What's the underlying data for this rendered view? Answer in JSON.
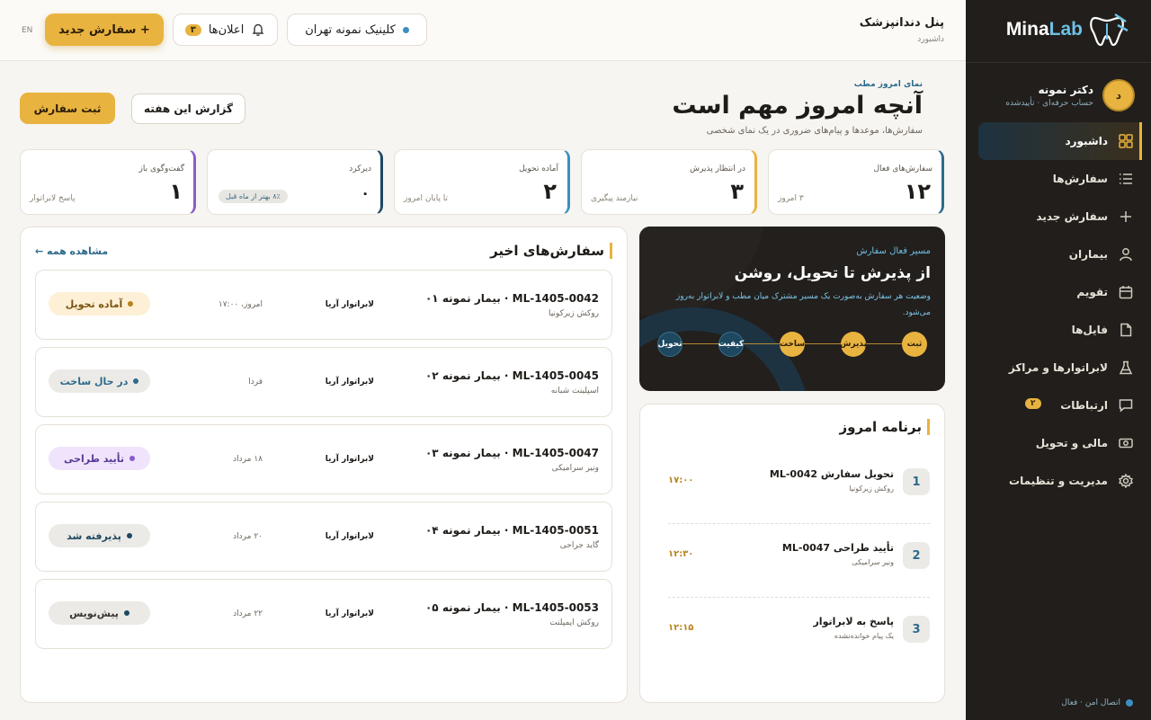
{
  "brand": {
    "name_a": "Mina",
    "name_b": "Lab"
  },
  "profile": {
    "initial": "د",
    "name": "دکتر نمونه",
    "sub": "حساب حرفه‌ای · تأییدشده"
  },
  "nav": [
    {
      "label": "داشبورد",
      "icon": "grid-icon"
    },
    {
      "label": "سفارش‌ها",
      "icon": "list-icon"
    },
    {
      "label": "سفارش جدید",
      "icon": "plus-icon"
    },
    {
      "label": "بیماران",
      "icon": "user-icon"
    },
    {
      "label": "تقویم",
      "icon": "calendar-icon"
    },
    {
      "label": "فایل‌ها",
      "icon": "file-icon"
    },
    {
      "label": "لابراتوارها و مراکز",
      "icon": "flask-icon"
    },
    {
      "label": "ارتباطات",
      "icon": "chat-icon",
      "badge": "۲"
    },
    {
      "label": "مالی و تحویل",
      "icon": "money-icon"
    },
    {
      "label": "مدیریت و تنظیمات",
      "icon": "gear-icon"
    }
  ],
  "footer": {
    "status": "اتصال امن · فعال"
  },
  "topbar": {
    "title": "پنل دندانپزشک",
    "breadcrumb": "داشبورد",
    "clinic": "کلینیک نمونه تهران",
    "notifications_label": "اعلان‌ها",
    "notifications_count": "۳",
    "new_order": "+ سفارش جدید",
    "lang": "EN"
  },
  "hero": {
    "kicker": "نمای امروز مطب",
    "title": "آنچه امروز مهم است",
    "subtitle": "سفارش‌ها، موعدها و پیام‌های ضروری در یک نمای شخصی",
    "report_button": "گزارش این هفته",
    "submit_button": "ثبت سفارش"
  },
  "stats": [
    {
      "label": "سفارش‌های فعال",
      "value": "۱۲",
      "sub": "۳ امروز",
      "color": "#2d6a8c"
    },
    {
      "label": "در انتظار پذیرش",
      "value": "۳",
      "sub": "نیازمند پیگیری",
      "color": "#e9b340"
    },
    {
      "label": "آماده تحویل",
      "value": "۲",
      "sub": "تا پایان امروز",
      "color": "#3b8fc0"
    },
    {
      "label": "دیرکرد",
      "value": "۰",
      "chip": "۸٪ بهتر از ماه قبل",
      "color": "#1d4860"
    },
    {
      "label": "گفت‌وگوی باز",
      "value": "۱",
      "sub": "پاسخ لابراتوار",
      "color": "#8a5cc8"
    }
  ],
  "recent": {
    "title": "سفارش‌های اخیر",
    "see_all": "مشاهده همه ←",
    "orders": [
      {
        "code": "ML-1405-0042 · بیمار نمونه ۰۱",
        "type": "روکش زیرکونیا",
        "lab": "لابراتوار آریا",
        "date": "امروز، ۱۷:۰۰",
        "status": "آماده تحویل",
        "bg": "#fdf0d6",
        "fg": "#7a5410",
        "dot": "#b8821c"
      },
      {
        "code": "ML-1405-0045 · بیمار نمونه ۰۲",
        "type": "اسپلینت شبانه",
        "lab": "لابراتوار آریا",
        "date": "فردا",
        "status": "در حال ساخت",
        "bg": "#eceae6",
        "fg": "#2d6a8c",
        "dot": "#2d6a8c"
      },
      {
        "code": "ML-1405-0047 · بیمار نمونه ۰۳",
        "type": "ونیر سرامیکی",
        "lab": "لابراتوار آریا",
        "date": "۱۸ مرداد",
        "status": "تأیید طراحی",
        "bg": "#efe4fb",
        "fg": "#5a3a93",
        "dot": "#8a5cc8"
      },
      {
        "code": "ML-1405-0051 · بیمار نمونه ۰۴",
        "type": "گاید جراحی",
        "lab": "لابراتوار آریا",
        "date": "۲۰ مرداد",
        "status": "پذیرفته شد",
        "bg": "#eceae6",
        "fg": "#1d4860",
        "dot": "#1d4860"
      },
      {
        "code": "ML-1405-0053 · بیمار نمونه ۰۵",
        "type": "روکش ایمپلنت",
        "lab": "لابراتوار آریا",
        "date": "۲۲ مرداد",
        "status": "پیش‌نویس",
        "bg": "#eceae6",
        "fg": "#3a3632",
        "dot": "#1d4860"
      }
    ]
  },
  "journey": {
    "kicker": "مسیر فعال سفارش",
    "title": "از پذیرش تا تحویل، روشن",
    "subtitle": "وضعیت هر سفارش به‌صورت یک مسیر مشترک میان مطب و لابراتوار به‌روز می‌شود.",
    "steps": [
      "ثبت",
      "پذیرش",
      "ساخت",
      "کیفیت",
      "تحویل"
    ],
    "done_steps": 3
  },
  "schedule": {
    "title": "برنامه امروز",
    "items": [
      {
        "num": "1",
        "title": "تحویل سفارش ML-0042",
        "sub": "روکش زیرکونیا",
        "time": "۱۷:۰۰"
      },
      {
        "num": "2",
        "title": "تأیید طراحی ML-0047",
        "sub": "ونیر سرامیکی",
        "time": "۱۲:۳۰"
      },
      {
        "num": "3",
        "title": "پاسخ به لابراتوار",
        "sub": "یک پیام خوانده‌نشده",
        "time": "۱۲:۱۵"
      }
    ]
  }
}
